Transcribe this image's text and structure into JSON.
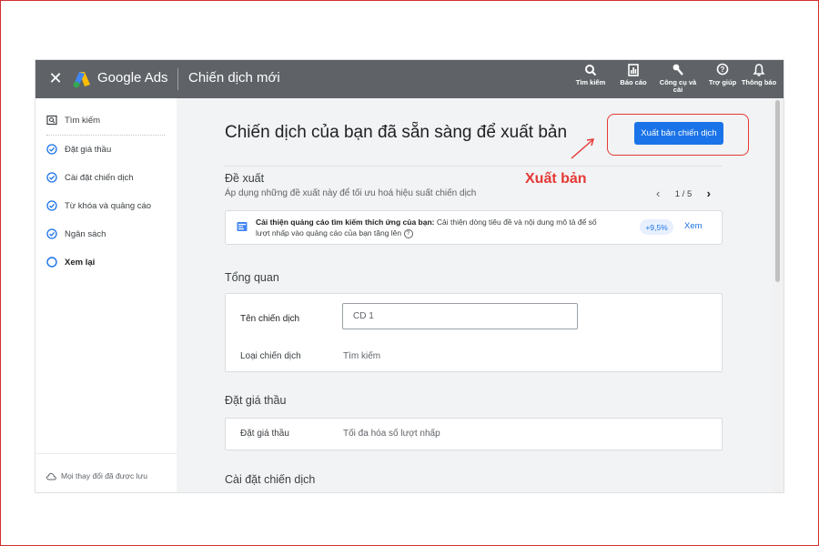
{
  "topbar": {
    "brand": "Google Ads",
    "campaign_title": "Chiến dịch mới",
    "items": [
      {
        "label": "Tìm kiếm",
        "icon": "search-icon"
      },
      {
        "label": "Báo cáo",
        "icon": "reports-icon"
      },
      {
        "label": "Công cụ và cài",
        "icon": "tools-icon"
      },
      {
        "label": "Trợ giúp",
        "icon": "help-icon"
      },
      {
        "label": "Thông báo",
        "icon": "bell-icon"
      }
    ]
  },
  "sidebar": {
    "items": [
      {
        "label": "Tìm kiếm",
        "icon": "search-campaign-icon"
      },
      {
        "label": "Đặt giá thầu",
        "icon": "check-circle-icon"
      },
      {
        "label": "Cài đặt chiến dịch",
        "icon": "check-circle-icon"
      },
      {
        "label": "Từ khóa và quảng cáo",
        "icon": "check-circle-icon"
      },
      {
        "label": "Ngân sách",
        "icon": "check-circle-icon"
      },
      {
        "label": "Xem lại",
        "icon": "empty-circle-icon"
      }
    ],
    "saved_status": "Mọi thay đổi đã được lưu"
  },
  "main": {
    "heading": "Chiến dịch của bạn đã sẵn sàng để xuất bản",
    "publish_button": "Xuất bản chiến dịch",
    "recommendations": {
      "title": "Đề xuất",
      "subtitle": "Áp dụng những đề xuất này để tối ưu hoá hiệu suất chiến dịch",
      "pager": "1 / 5",
      "card_title": "Cải thiện quảng cáo tìm kiếm thích ứng của bạn:",
      "card_text": "Cải thiện dòng tiêu đề và nội dung mô tả để số lượt nhấp vào quảng cáo của bạn tăng lên",
      "badge": "+9,5%",
      "view_link": "Xem"
    },
    "overview": {
      "title": "Tổng quan",
      "campaign_name_label": "Tên chiến dịch",
      "campaign_name_value": "CD 1",
      "campaign_type_label": "Loại chiến dịch",
      "campaign_type_value": "Tìm kiếm"
    },
    "bidding": {
      "title": "Đặt giá thầu",
      "label": "Đặt giá thầu",
      "value": "Tối đa hóa số lượt nhấp"
    },
    "settings": {
      "title": "Cài đặt chiến dịch"
    }
  },
  "annotation": {
    "text": "Xuất bản",
    "color": "#e53935"
  },
  "colors": {
    "accent": "#1a73e8",
    "topbar": "#5f6368",
    "annotation": "#e53935"
  }
}
